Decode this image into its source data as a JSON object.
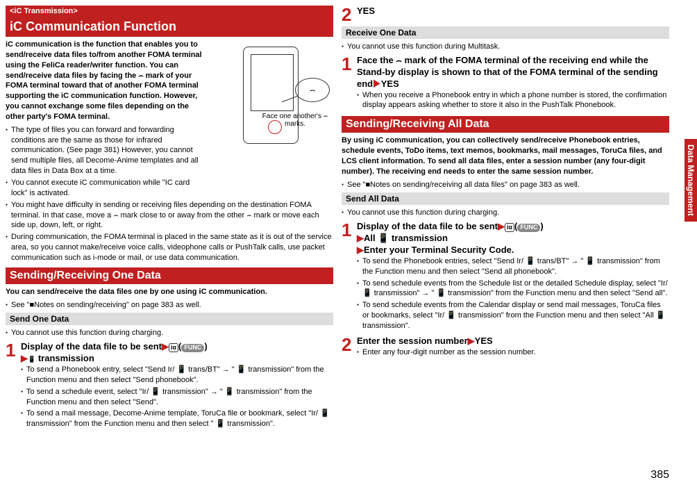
{
  "left": {
    "tag": "<iC Transmission>",
    "title": "iC Communication Function",
    "intro": "iC communication is the function that enables you to send/receive data files to/from another FOMA terminal using the FeliCa reader/writer function. You can send/receive data files by facing the ⌢ mark of your FOMA terminal toward that of another FOMA terminal supporting the iC communication function. However, you cannot exchange some files depending on the other party's FOMA terminal.",
    "bullets": [
      "The type of files you can forward and forwarding conditions are the same as those for infrared communication. (See page 381) However, you cannot send multiple files, all Decome-Anime templates and all data files in Data Box at a time.",
      "You cannot execute iC communication while \"IC card lock\" is activated.",
      "You might have difficulty in sending or receiving files depending on the destination FOMA terminal. In that case, move a ⌢ mark close to or away from the other ⌢ mark or move each side up, down, left, or right.",
      "During communication, the FOMA terminal is placed in the same state as it is out of the service area, so you cannot make/receive voice calls, videophone calls or PushTalk calls, use packet communication such as i-mode or mail, or use data communication."
    ],
    "diagram_caption": "Face one another's ⌢ marks.",
    "section2": "Sending/Receiving One Data",
    "intro2": "You can send/receive the data files one by one using iC communication.",
    "note": "See \"■Notes on sending/receiving\" on page 383 as well.",
    "subheader1": "Send One Data",
    "pre1": "You cannot use this function during charging.",
    "step1_label": "Display of the data file to be sent",
    "step1_label2": "transmission",
    "step1_bullets": [
      "To send a Phonebook entry, select \"Send Ir/ 📱 trans/BT\" → \" 📱 transmission\" from the Function menu and then select \"Send phonebook\".",
      "To send a schedule event, select \"Ir/ 📱 transmission\" → \" 📱 transmission\" from the Function menu and then select \"Send\".",
      "To send a mail message, Decome-Anime template, ToruCa file or bookmark, select \"Ir/ 📱 transmission\" from the Function menu and then select \" 📱 transmission\"."
    ]
  },
  "right": {
    "step2": "YES",
    "subheader2": "Receive One Data",
    "pre2": "You cannot use this function during Multitask.",
    "step_r1": "Face the ⌢ mark of the FOMA terminal of the receiving end while the Stand-by display is shown to that of the FOMA terminal of the sending end",
    "step_r1_after": "YES",
    "step_r1_bullet": "When you receive a Phonebook entry in which a phone number is stored, the confirmation display appears asking whether to store it also in the PushTalk Phonebook.",
    "section3": "Sending/Receiving All Data",
    "intro3": "By using iC communication, you can collectively send/receive Phonebook entries, schedule events, ToDo items, text memos, bookmarks, mail messages, ToruCa files, and LCS client information. To send all data files, enter a session number (any four-digit number). The receiving end needs to enter the same session number.",
    "note3": "See \"■Notes on sending/receiving all data files\" on page 383 as well.",
    "subheader3": "Send All Data",
    "pre3": "You cannot use this function during charging.",
    "step_s1_line1": "Display of the data file to be sent",
    "step_s1_line2": "All 📱 transmission",
    "step_s1_line3": "Enter your Terminal Security Code.",
    "step_s1_bullets": [
      "To send the Phonebook entries, select \"Send Ir/ 📱 trans/BT\" → \" 📱 transmission\" from the Function menu and then select \"Send all phonebook\".",
      "To send schedule events from the Schedule list or the detailed Schedule display, select \"Ir/ 📱 transmission\" → \" 📱 transmission\" from the Function menu and then select \"Send all\".",
      "To send schedule events from the Calendar display or send mail messages, ToruCa files or bookmarks, select \"Ir/ 📱 transmission\" from the Function menu and then select \"All 📱 transmission\"."
    ],
    "step_s2": "Enter the session number",
    "step_s2_after": "YES",
    "step_s2_bullet": "Enter any four-digit number as the session number."
  },
  "func_label": "FUNC",
  "side_tab": "Data Management",
  "page_num": "385"
}
